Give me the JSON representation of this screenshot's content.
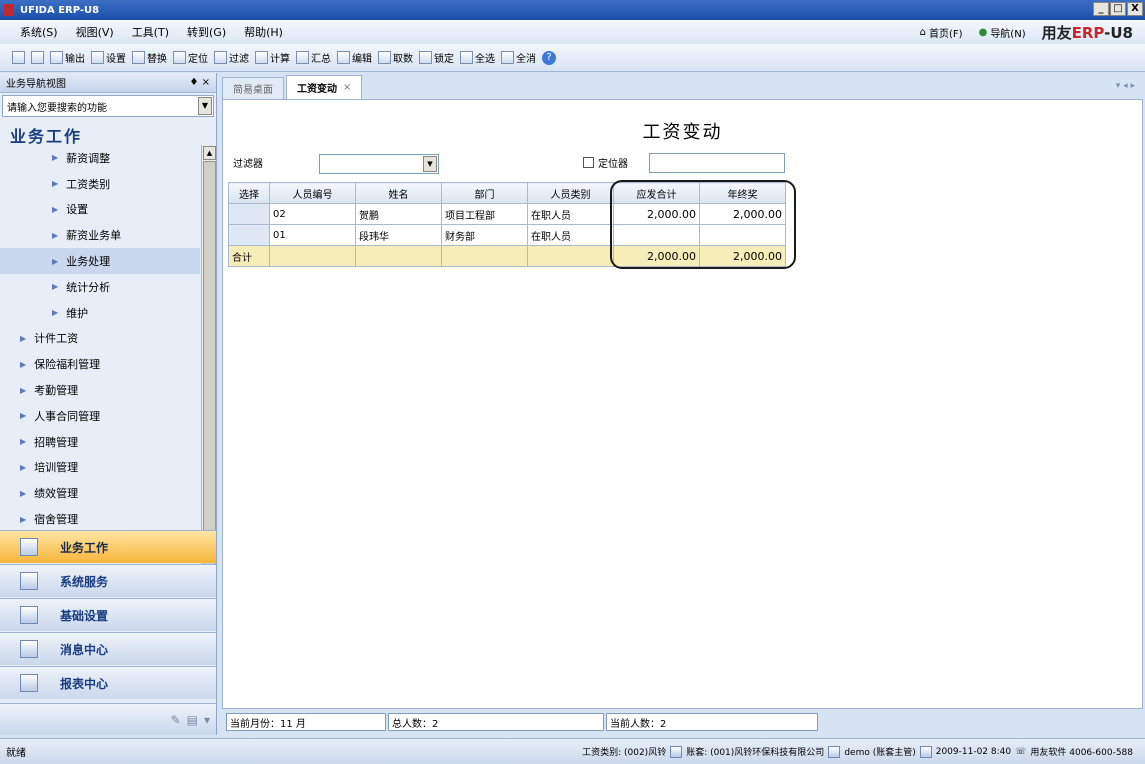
{
  "window": {
    "title": "UFIDA ERP-U8",
    "btn_min": "_",
    "btn_max": "□",
    "btn_close": "X"
  },
  "menu": [
    "系统(S)",
    "视图(V)",
    "工具(T)",
    "转到(G)",
    "帮助(H)"
  ],
  "header_links": {
    "home": "首页(F)",
    "nav": "导航(N)",
    "brand_prefix": "用友",
    "brand_erp": "ERP",
    "brand_suffix": "-U8"
  },
  "toolbar": {
    "print": "",
    "preview": "",
    "output": "输出",
    "settings": "设置",
    "replace": "替换",
    "locate": "定位",
    "filter": "过滤",
    "calc": "计算",
    "summary": "汇总",
    "edit": "编辑",
    "fetch": "取数",
    "lock": "锁定",
    "select_all": "全选",
    "deselect_all": "全消",
    "help": "?"
  },
  "left_panel": {
    "header": "业务导航视图",
    "header_controls": "♦ ×",
    "search_placeholder": "请输入您要搜索的功能",
    "section_title": "业务工作",
    "tree": [
      {
        "label": "薪资调整",
        "level": "sub"
      },
      {
        "label": "工资类别",
        "level": "sub"
      },
      {
        "label": "设置",
        "level": "sub"
      },
      {
        "label": "薪资业务单",
        "level": "sub"
      },
      {
        "label": "业务处理",
        "level": "sub",
        "selected": true
      },
      {
        "label": "统计分析",
        "level": "sub"
      },
      {
        "label": "维护",
        "level": "sub"
      },
      {
        "label": "计件工资",
        "level": "top"
      },
      {
        "label": "保险福利管理",
        "level": "top"
      },
      {
        "label": "考勤管理",
        "level": "top"
      },
      {
        "label": "人事合同管理",
        "level": "top"
      },
      {
        "label": "招聘管理",
        "level": "top"
      },
      {
        "label": "培训管理",
        "level": "top"
      },
      {
        "label": "绩效管理",
        "level": "top"
      },
      {
        "label": "宿舍管理",
        "level": "top"
      }
    ],
    "nav_buttons": [
      "业务工作",
      "系统服务",
      "基础设置",
      "消息中心",
      "报表中心"
    ]
  },
  "tabs": [
    {
      "label": "简易桌面",
      "active": false
    },
    {
      "label": "工资变动",
      "active": true
    }
  ],
  "tab_controls": "▾ ◂ ▸",
  "doc": {
    "title": "工资变动",
    "filter_label": "过滤器",
    "locator_label": "定位器"
  },
  "grid": {
    "columns": [
      "选择",
      "人员编号",
      "姓名",
      "部门",
      "人员类别",
      "应发合计",
      "年终奖"
    ],
    "rows": [
      [
        "",
        "02",
        "贺鹏",
        "项目工程部",
        "在职人员",
        "2,000.00",
        "2,000.00"
      ],
      [
        "",
        "01",
        "段玮华",
        "财务部",
        "在职人员",
        "",
        ""
      ]
    ],
    "total": [
      "合计",
      "",
      "",
      "",
      "",
      "2,000.00",
      "2,000.00"
    ]
  },
  "inner_status": {
    "month": "当前月份：11 月",
    "total_people": "总人数：2",
    "current_people": "当前人数：2"
  },
  "statusbar": {
    "ready": "就绪",
    "wage_type": "工资类别: (002)风铃",
    "account": "账套: (001)风铃环保科技有限公司",
    "user": "demo (账套主管)",
    "datetime": "2009-11-02 8:40",
    "vendor": "用友软件 4006-600-588"
  }
}
